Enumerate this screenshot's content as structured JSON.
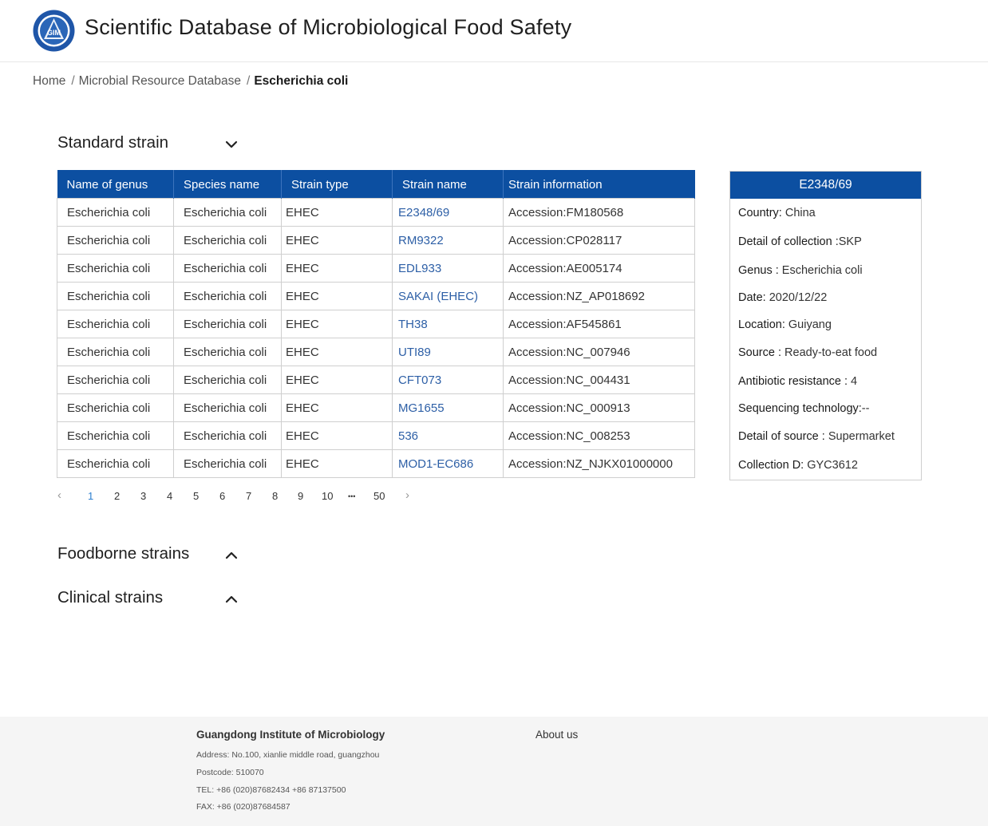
{
  "header": {
    "title": "Scientific Database of Microbiological Food Safety",
    "logo_text": "GIM"
  },
  "breadcrumb": {
    "home": "Home",
    "parent": "Microbial Resource Database",
    "current": "Escherichia coli"
  },
  "sections": {
    "standard": "Standard strain",
    "foodborne": "Foodborne strains",
    "clinical": "Clinical strains"
  },
  "table": {
    "headers": [
      "Name of genus",
      "Species name",
      "Strain type",
      "Strain name",
      "Strain information"
    ],
    "rows": [
      [
        "Escherichia coli",
        "Escherichia coli",
        "EHEC",
        "E2348/69",
        "Accession:FM180568"
      ],
      [
        "Escherichia coli",
        "Escherichia coli",
        "EHEC",
        "RM9322",
        "Accession:CP028117"
      ],
      [
        "Escherichia coli",
        "Escherichia coli",
        "EHEC",
        "EDL933",
        "Accession:AE005174"
      ],
      [
        "Escherichia coli",
        "Escherichia coli",
        "EHEC",
        "SAKAI (EHEC)",
        "Accession:NZ_AP018692"
      ],
      [
        "Escherichia coli",
        "Escherichia coli",
        "EHEC",
        "TH38",
        "Accession:AF545861"
      ],
      [
        "Escherichia coli",
        "Escherichia coli",
        "EHEC",
        "UTI89",
        "Accession:NC_007946"
      ],
      [
        "Escherichia coli",
        "Escherichia coli",
        "EHEC",
        "CFT073",
        "Accession:NC_004431"
      ],
      [
        "Escherichia coli",
        "Escherichia coli",
        "EHEC",
        "MG1655",
        "Accession:NC_000913"
      ],
      [
        "Escherichia coli",
        "Escherichia coli",
        "EHEC",
        "536",
        "Accession:NC_008253"
      ],
      [
        "Escherichia coli",
        "Escherichia coli",
        "EHEC",
        "MOD1-EC686",
        "Accession:NZ_NJKX01000000"
      ]
    ]
  },
  "pagination": {
    "prev": "‹",
    "next": "›",
    "pages": [
      "1",
      "2",
      "3",
      "4",
      "5",
      "6",
      "7",
      "8",
      "9",
      "10"
    ],
    "ellipsis": "•••",
    "last": "50",
    "active": "1"
  },
  "info_panel": {
    "title": "E2348/69",
    "rows": [
      {
        "label": "Country:",
        "value": " China"
      },
      {
        "label": "Detail of collection :",
        "value": "SKP"
      },
      {
        "label": "Genus :",
        "value": " Escherichia coli"
      },
      {
        "label": "Date:",
        "value": " 2020/12/22"
      },
      {
        "label": "Location:",
        "value": " Guiyang"
      },
      {
        "label": "Source :",
        "value": " Ready-to-eat food"
      },
      {
        "label": "Antibiotic resistance :",
        "value": " 4"
      },
      {
        "label": "Sequencing technology:",
        "value": "--"
      },
      {
        "label": "Detail of source :",
        "value": " Supermarket"
      },
      {
        "label": "Collection D:",
        "value": " GYC3612"
      }
    ]
  },
  "footer": {
    "org": "Guangdong Institute of Microbiology",
    "about": "About us",
    "address": "Address: No.100, xianlie middle road, guangzhou",
    "postcode": "Postcode: 510070",
    "tel": "TEL: +86 (020)87682434   +86 87137500",
    "fax": "FAX: +86 (020)87684587"
  },
  "colors": {
    "header_blue": "#0c4fa1",
    "link_blue": "#2d5fa6",
    "active_page": "#2d7fd0"
  }
}
